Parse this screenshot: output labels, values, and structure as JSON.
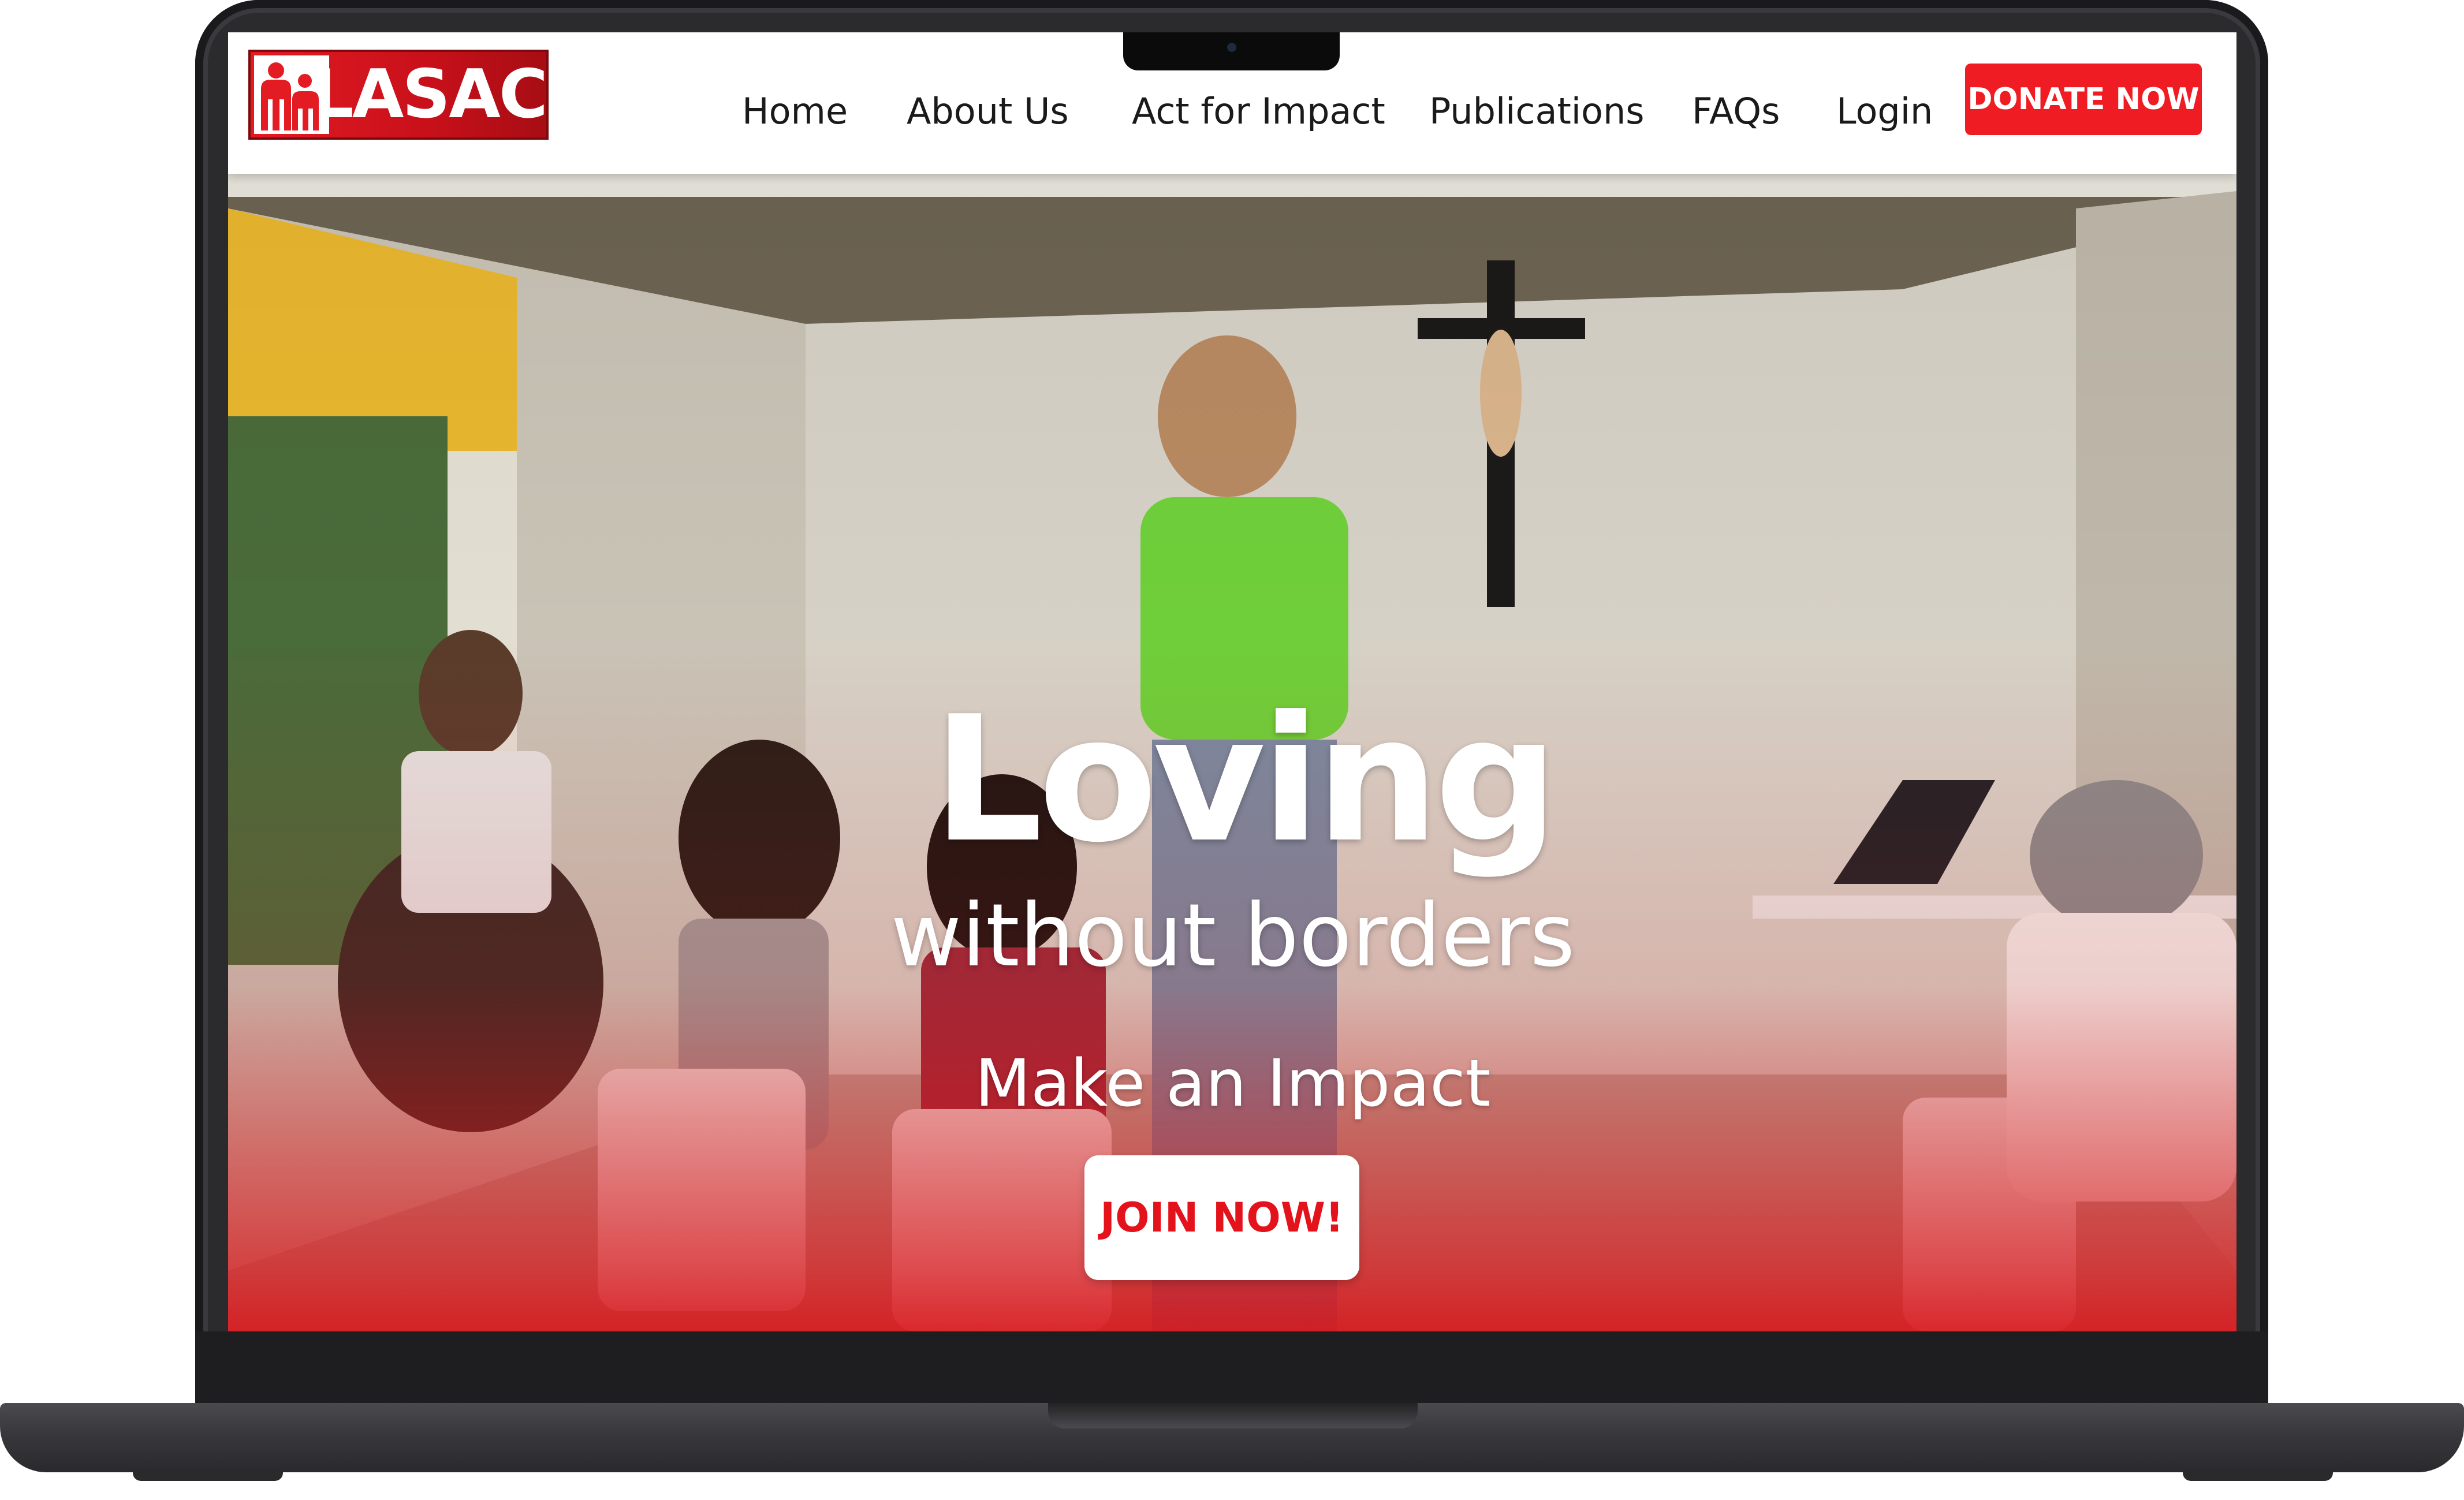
{
  "site": {
    "logo_text": "LASAC",
    "logo_icon": "lasac-figures-logo-icon"
  },
  "nav": {
    "items": [
      {
        "label": "Home"
      },
      {
        "label": "About Us"
      },
      {
        "label": "Act for Impact"
      },
      {
        "label": "Publications"
      },
      {
        "label": "FAQs"
      },
      {
        "label": "Login"
      }
    ],
    "donate_label": "DONATE NOW"
  },
  "hero": {
    "title": "Loving",
    "subtitle": "without borders",
    "tagline": "Make an Impact",
    "cta_label": "JOIN NOW!"
  },
  "colors": {
    "brand_red": "#ef1c24",
    "cta_text_red": "#e3121b",
    "laptop_body": "#2b2b2e"
  }
}
